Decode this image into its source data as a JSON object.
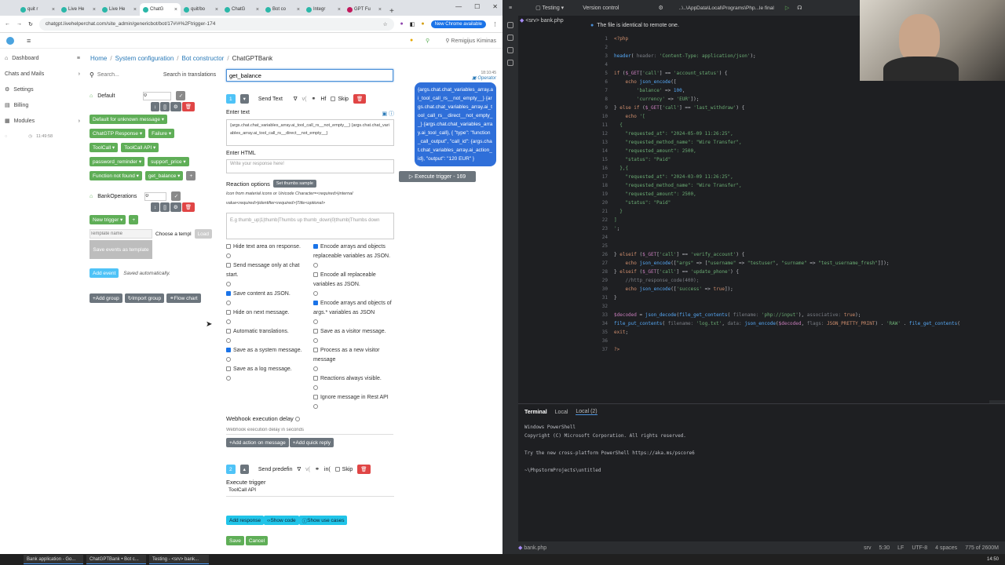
{
  "browser": {
    "tabs": [
      "quit r",
      "Live He",
      "Live He",
      "ChatG",
      "quit/bo",
      "ChatG",
      "Bot co",
      "Integr",
      "GPT Fu"
    ],
    "url": "chatgpt.livehelperchat.com/site_admin/genericbot/bot/17#!#%2Ftrigger-174",
    "chrome_available": "New Chrome available"
  },
  "app": {
    "user": "Remigijus Kiminas",
    "nav": [
      "Dashboard",
      "Chats and Mails",
      "Settings",
      "Billing",
      "Modules"
    ],
    "time": "11:49:58",
    "breadcrumb": [
      "Home",
      "System configuration",
      "Bot constructor",
      "ChatGPTBank"
    ],
    "search_placeholder": "Search...",
    "search_translations": "Search in translations",
    "group_default": "Default",
    "group_default_count": "0",
    "triggers": [
      [
        "Default for unknown message",
        "Failure"
      ],
      [
        "ChatGTP Response",
        "Failure"
      ],
      [
        "ToolCall",
        "ToolCall API"
      ],
      [
        "password_reminder",
        "support_price"
      ],
      [
        "Function not found",
        "get_balance"
      ]
    ],
    "group_bank": "BankOperations",
    "group_bank_count": "0",
    "new_trigger": "New trigger",
    "template_name_placeholder": "Template name",
    "choose_template": "Choose a templ",
    "load": "Load",
    "save_events": "Save events as template",
    "add_event": "Add event",
    "saved_auto": "Saved automatically.",
    "add_group": "Add group",
    "import_group": "Import group",
    "flow_chart": "Flow chart"
  },
  "trigger": {
    "name": "get_balance",
    "action1_num": "1",
    "action1_type": "Send Text",
    "skip": "Skip",
    "enter_text_label": "Enter text",
    "enter_text_value": "{args.chat.chat_variables_array.ai_tool_call_rs__not_empty__} {args.chat.chat_variables_array.ai_tool_call_rs__direct__not_empty__}",
    "enter_html_label": "Enter HTML",
    "enter_html_placeholder": "Write your response here!",
    "reaction_label": "Reaction options",
    "set_thumbs": "Set thumbs sample",
    "reaction_help": "Icon from material icons or Unicode Character=<required>|internal value<required>|identifier<required>|Title<optional>",
    "reaction_placeholder": "E.g thumb_up|1|thumb|Thumbs up thumb_down|0|thumb|Thumbs down",
    "checks_left": [
      [
        "Hide text area on response.",
        false
      ],
      [
        "Send message only at chat start.",
        false
      ],
      [
        "Save content as JSON.",
        true
      ],
      [
        "Hide on next message.",
        false
      ],
      [
        "Automatic translations.",
        false
      ],
      [
        "Save as a system message.",
        true
      ],
      [
        "Save as a log message.",
        false
      ]
    ],
    "checks_right": [
      [
        "Encode arrays and objects replaceable variables as JSON.",
        true
      ],
      [
        "Encode all replaceable variables as JSON.",
        false
      ],
      [
        "Encode arrays and objects of args.* variables as JSON",
        true
      ],
      [
        "Save as a visitor message.",
        false
      ],
      [
        "Process as a new visitor message",
        false
      ],
      [
        "Reactions always visible.",
        false
      ],
      [
        "Ignore message in Rest API",
        false
      ]
    ],
    "webhook_label": "Webhook execution delay",
    "webhook_placeholder": "Webhook execution delay in seconds",
    "add_action_msg": "Add action on message",
    "add_quick_reply": "Add quick reply",
    "action2_num": "2",
    "action2_type": "Send predefin",
    "execute_trigger_label": "Execute trigger",
    "execute_trigger_value": "ToolCall API",
    "add_response": "Add response",
    "show_code": "Show code",
    "show_use_cases": "Show use cases",
    "save": "Save",
    "cancel": "Cancel"
  },
  "preview": {
    "time": "18:10:45",
    "role": "Operator",
    "bubble": "{args.chat.chat_variables_array.ai_tool_call_rs__not_empty__} {args.chat.chat_variables_array.ai_tool_call_rs__direct__not_empty__} {args.chat.chat_variables_array.ai_tool_call}, { \"type\": \"function_call_output\", \"call_id\": {args.chat.chat_variables_array.ai_action_id}, \"output\": \"120 EUR\" }",
    "execute_btn": "Execute trigger - 169"
  },
  "ide": {
    "project": "Testing",
    "vcs": "Version control",
    "path": "..\\..\\AppData\\Local\\Programs\\Php...le final",
    "file_tab": "<srv> bank.php",
    "notice": "The file is identical to remote one.",
    "terminal_tabs": [
      "Terminal",
      "Local",
      "Local (2)"
    ],
    "terminal_lines": [
      "Windows PowerShell",
      "Copyright (C) Microsoft Corporation. All rights reserved.",
      "",
      "Try the new cross-platform PowerShell https://aka.ms/pscore6",
      "",
      "~\\PhpstormProjects\\untitled"
    ],
    "status_file": "bank.php",
    "status_right": [
      "srv",
      "5:30",
      "LF",
      "UTF-8",
      "4 spaces",
      "775 of 2600M"
    ]
  },
  "taskbar": [
    "Bank application - Go...",
    "ChatGPTBank • Bot c...",
    "Testing - <srv> bank..."
  ],
  "clock": "14:50"
}
